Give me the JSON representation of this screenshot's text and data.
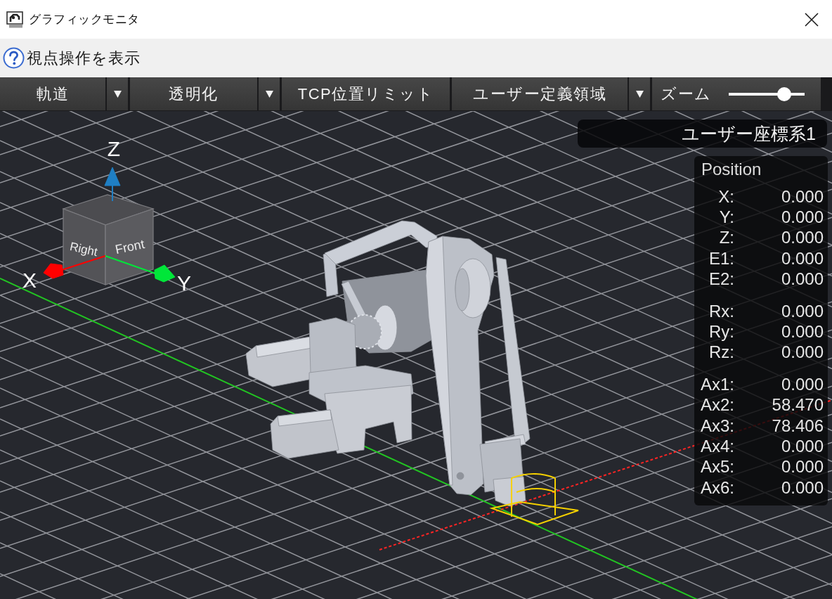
{
  "window": {
    "title": "グラフィックモニタ"
  },
  "help": {
    "label": "視点操作を表示"
  },
  "toolbar": {
    "items": [
      {
        "kind": "dropdown",
        "label": "軌道"
      },
      {
        "kind": "dropdown",
        "label": "透明化"
      },
      {
        "kind": "button",
        "label": "TCP位置リミット"
      },
      {
        "kind": "dropdown",
        "label": "ユーザー定義領域"
      },
      {
        "kind": "slider",
        "label": "ズーム",
        "level": 0.74
      }
    ]
  },
  "view_cube": {
    "faces": [
      {
        "kind": "left",
        "label": "Right"
      },
      {
        "kind": "right",
        "label": "Front"
      }
    ],
    "axes": [
      {
        "kind": "z",
        "label": "Z",
        "color": "#1f7fc4"
      },
      {
        "kind": "x",
        "label": "X",
        "color": "#ff0000"
      },
      {
        "kind": "y",
        "label": "Y",
        "color": "#00e639"
      }
    ]
  },
  "coordinate_system": {
    "label": "ユーザー座標系1"
  },
  "position": {
    "title": "Position",
    "groups": [
      {
        "rows": [
          {
            "label": "X:",
            "value": "0.000"
          },
          {
            "label": "Y:",
            "value": "0.000"
          },
          {
            "label": "Z:",
            "value": "0.000"
          },
          {
            "label": "E1:",
            "value": "0.000"
          },
          {
            "label": "E2:",
            "value": "0.000"
          }
        ]
      },
      {
        "rows": [
          {
            "label": "Rx:",
            "value": "0.000"
          },
          {
            "label": "Ry:",
            "value": "0.000"
          },
          {
            "label": "Rz:",
            "value": "0.000"
          }
        ]
      },
      {
        "rows": [
          {
            "label": "Ax1:",
            "value": "0.000"
          },
          {
            "label": "Ax2:",
            "value": "58.470"
          },
          {
            "label": "Ax3:",
            "value": "78.406"
          },
          {
            "label": "Ax4:",
            "value": "0.000"
          },
          {
            "label": "Ax5:",
            "value": "0.000"
          },
          {
            "label": "Ax6:",
            "value": "0.000"
          }
        ]
      }
    ]
  }
}
